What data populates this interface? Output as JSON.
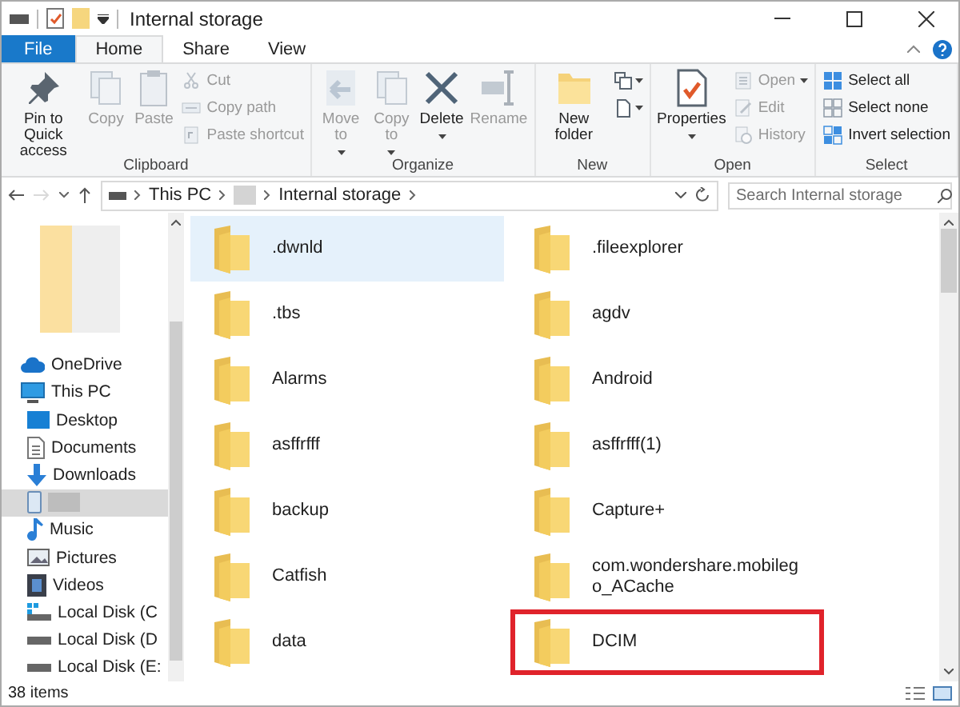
{
  "window": {
    "title": "Internal storage"
  },
  "tabs": [
    {
      "label": "File",
      "kind": "file",
      "selected": false
    },
    {
      "label": "Home",
      "kind": "tab",
      "selected": true
    },
    {
      "label": "Share",
      "kind": "tab",
      "selected": false
    },
    {
      "label": "View",
      "kind": "tab",
      "selected": false
    }
  ],
  "ribbon": {
    "groups": [
      {
        "label": "Clipboard",
        "buttons": [
          {
            "label": "Pin to Quick access",
            "kind": "large",
            "disabled": false,
            "dropdown": false
          },
          {
            "label": "Copy",
            "kind": "large",
            "disabled": true,
            "dropdown": false
          },
          {
            "label": "Paste",
            "kind": "large",
            "disabled": true,
            "dropdown": false
          },
          {
            "label": "Cut",
            "kind": "small",
            "disabled": true,
            "dropdown": false
          },
          {
            "label": "Copy path",
            "kind": "small",
            "disabled": true,
            "dropdown": false
          },
          {
            "label": "Paste shortcut",
            "kind": "small",
            "disabled": true,
            "dropdown": false
          }
        ]
      },
      {
        "label": "Organize",
        "buttons": [
          {
            "label": "Move to",
            "kind": "large",
            "disabled": true,
            "dropdown": true
          },
          {
            "label": "Copy to",
            "kind": "large",
            "disabled": true,
            "dropdown": true
          },
          {
            "label": "Delete",
            "kind": "large",
            "disabled": false,
            "dropdown": true
          },
          {
            "label": "Rename",
            "kind": "large",
            "disabled": true,
            "dropdown": false
          }
        ]
      },
      {
        "label": "New",
        "buttons": [
          {
            "label": "New folder",
            "kind": "large",
            "disabled": false,
            "dropdown": false
          },
          {
            "kind": "icon",
            "disabled": false,
            "dropdown": true
          },
          {
            "kind": "icon",
            "disabled": false,
            "dropdown": true
          }
        ]
      },
      {
        "label": "Open",
        "buttons": [
          {
            "label": "Properties",
            "kind": "large",
            "disabled": false,
            "dropdown": true
          },
          {
            "label": "Open",
            "kind": "small",
            "disabled": true,
            "dropdown": true
          },
          {
            "label": "Edit",
            "kind": "small",
            "disabled": true,
            "dropdown": false
          },
          {
            "label": "History",
            "kind": "small",
            "disabled": true,
            "dropdown": false
          }
        ]
      },
      {
        "label": "Select",
        "buttons": [
          {
            "label": "Select all",
            "kind": "small",
            "disabled": false,
            "dropdown": false
          },
          {
            "label": "Select none",
            "kind": "small",
            "disabled": false,
            "dropdown": false
          },
          {
            "label": "Invert selection",
            "kind": "small",
            "disabled": false,
            "dropdown": false
          }
        ]
      }
    ]
  },
  "address_bar": {
    "segments": [
      "This PC",
      "Internal storage"
    ]
  },
  "search": {
    "placeholder": "Search Internal storage"
  },
  "navigation": [
    {
      "label": "OneDrive",
      "selected": false
    },
    {
      "label": "This PC",
      "selected": false,
      "children": [
        {
          "label": "Desktop",
          "selected": false
        },
        {
          "label": "Documents",
          "selected": false
        },
        {
          "label": "Downloads",
          "selected": false
        },
        {
          "selected": true
        },
        {
          "label": "Music",
          "selected": false
        },
        {
          "label": "Pictures",
          "selected": false
        },
        {
          "label": "Videos",
          "selected": false
        },
        {
          "label": "Local Disk (C",
          "selected": false
        },
        {
          "label": "Local Disk (D",
          "selected": false
        },
        {
          "label": "Local Disk (E:",
          "selected": false
        }
      ]
    }
  ],
  "items": [
    {
      "name": ".dwnld",
      "selected": true,
      "outlined": false
    },
    {
      "name": ".fileexplorer",
      "selected": false,
      "outlined": false
    },
    {
      "name": ".tbs",
      "selected": false,
      "outlined": false
    },
    {
      "name": "agdv",
      "selected": false,
      "outlined": false
    },
    {
      "name": "Alarms",
      "selected": false,
      "outlined": false
    },
    {
      "name": "Android",
      "selected": false,
      "outlined": false
    },
    {
      "name": "asffrfff",
      "selected": false,
      "outlined": false
    },
    {
      "name": "asffrfff(1)",
      "selected": false,
      "outlined": false
    },
    {
      "name": "backup",
      "selected": false,
      "outlined": false
    },
    {
      "name": "Capture+",
      "selected": false,
      "outlined": false
    },
    {
      "name": "Catfish",
      "selected": false,
      "outlined": false
    },
    {
      "name": "com.wondershare.mobilego_ACache",
      "selected": false,
      "outlined": false
    },
    {
      "name": "data",
      "selected": false,
      "outlined": false
    },
    {
      "name": "DCIM",
      "selected": false,
      "outlined": true
    }
  ],
  "status_bar": {
    "item_count": "38 items"
  }
}
